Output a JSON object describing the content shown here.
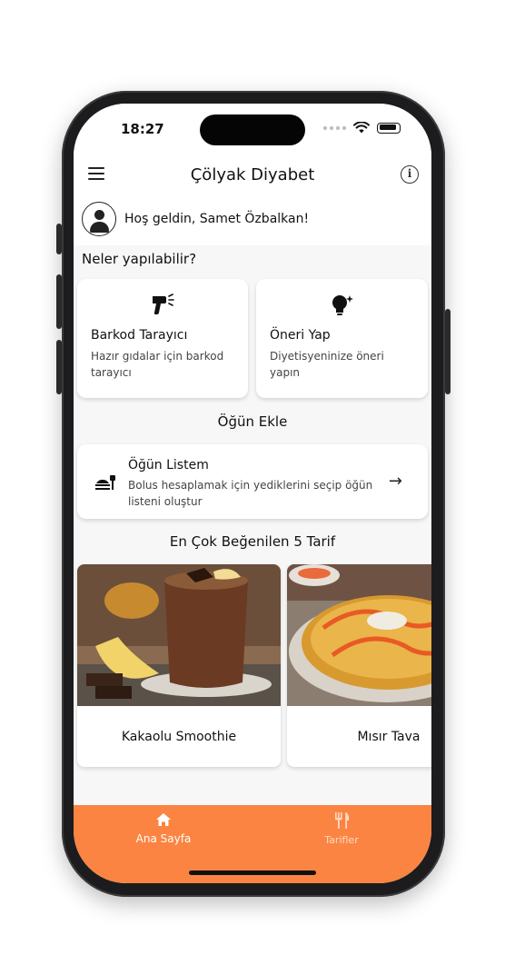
{
  "status": {
    "time": "18:27"
  },
  "appbar": {
    "title": "Çölyak Diyabet"
  },
  "welcome": {
    "text": "Hoş geldin, Samet Özbalkan!"
  },
  "actions": {
    "heading": "Neler yapılabilir?",
    "barcode": {
      "title": "Barkod Tarayıcı",
      "desc": "Hazır gıdalar için barkod tarayıcı"
    },
    "suggest": {
      "title": "Öneri Yap",
      "desc": "Diyetisyeninize öneri yapın"
    }
  },
  "meal": {
    "heading": "Öğün Ekle",
    "title": "Öğün Listem",
    "desc": "Bolus hesaplamak için yediklerini seçip öğün listeni oluştur"
  },
  "recipes": {
    "heading": "En Çok Beğenilen 5 Tarif",
    "items": [
      {
        "name": "Kakaolu Smoothie"
      },
      {
        "name": "Mısır Tava"
      }
    ]
  },
  "bottom_nav": {
    "items": [
      {
        "label": "Ana Sayfa",
        "icon": "home-icon",
        "active": true
      },
      {
        "label": "Tarifler",
        "icon": "fork-knife-icon",
        "active": false
      }
    ]
  },
  "colors": {
    "accent": "#fb8442",
    "background": "#f7f7f7"
  }
}
